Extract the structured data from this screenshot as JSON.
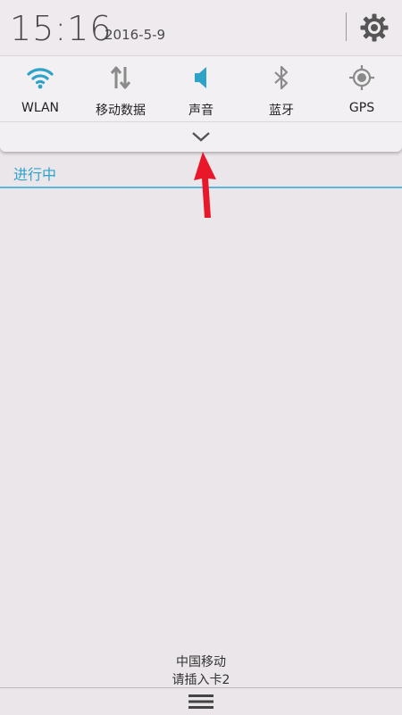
{
  "status": {
    "time": "15:16",
    "date": "2016-5-9"
  },
  "settings": {
    "icon": "gear-icon"
  },
  "quick_toggles": [
    {
      "label": "WLAN",
      "icon": "wifi-icon",
      "active": true
    },
    {
      "label": "移动数据",
      "icon": "mobile-data-icon",
      "active": false
    },
    {
      "label": "声音",
      "icon": "sound-icon",
      "active": true
    },
    {
      "label": "蓝牙",
      "icon": "bluetooth-icon",
      "active": false
    },
    {
      "label": "GPS",
      "icon": "gps-icon",
      "active": false
    }
  ],
  "notifications": {
    "section_title": "进行中"
  },
  "carrier": {
    "line1": "中国移动",
    "line2": "请插入卡2"
  },
  "colors": {
    "accent": "#2ea3c8",
    "arrow": "#e8182a",
    "inactive_icon": "#8a8a8a"
  }
}
